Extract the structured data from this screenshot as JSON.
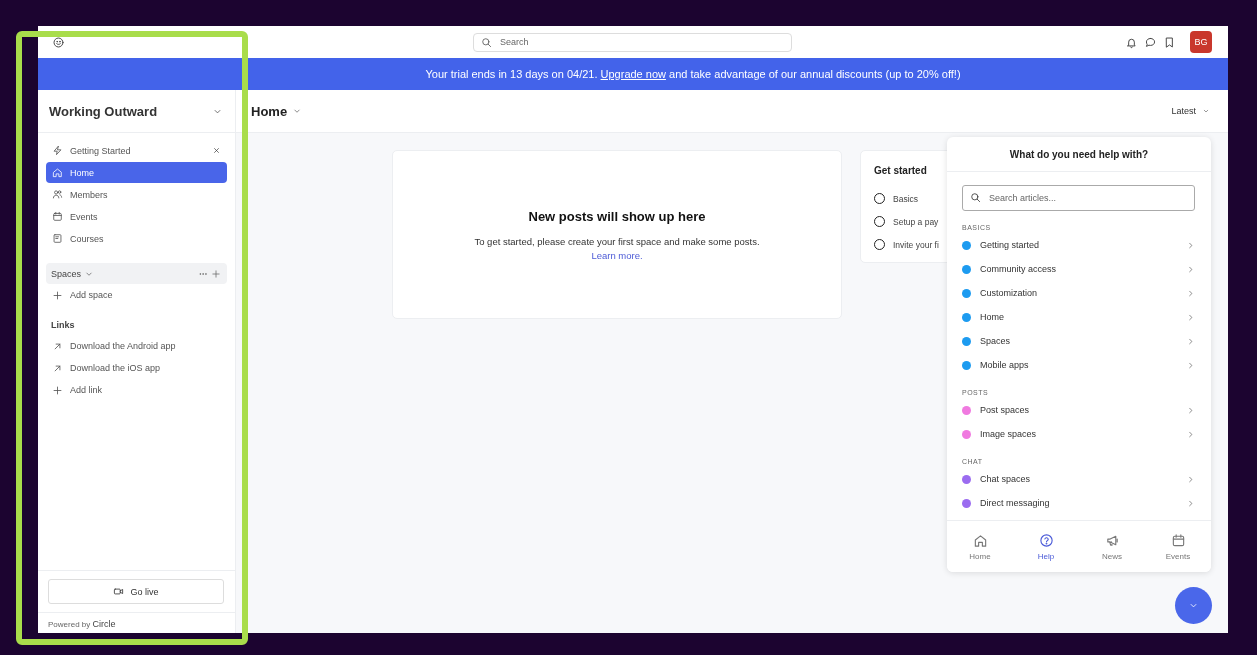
{
  "topbar": {
    "search": {
      "placeholder": "Search"
    },
    "avatar": "BG"
  },
  "banner": {
    "before": "Your trial ends in 13 days on 04/21.",
    "link": "Upgrade now",
    "after": "and take advantage of our annual discounts (up to 20% off!)"
  },
  "sidebar": {
    "title": "Working Outward",
    "nav": [
      {
        "label": "Getting Started",
        "kind": "bolt",
        "closable": true,
        "selected": false
      },
      {
        "label": "Home",
        "kind": "home",
        "closable": false,
        "selected": true
      },
      {
        "label": "Members",
        "kind": "people",
        "closable": false,
        "selected": false
      },
      {
        "label": "Events",
        "kind": "calendar",
        "closable": false,
        "selected": false
      },
      {
        "label": "Courses",
        "kind": "book",
        "closable": false,
        "selected": false
      }
    ],
    "spaces": {
      "label": "Spaces",
      "add": "Add space"
    },
    "links_heading": "Links",
    "links": [
      {
        "label": "Download the Android app",
        "kind": "external"
      },
      {
        "label": "Download the iOS app",
        "kind": "external"
      },
      {
        "label": "Add link",
        "kind": "add"
      }
    ],
    "go_live": "Go live",
    "powered": "Powered by **Circle**"
  },
  "main": {
    "title": "Home",
    "sort": "Latest",
    "empty": {
      "heading": "New posts will show up here",
      "text": "To get started, please create your first space and make some posts.",
      "link": "Learn more."
    },
    "get_started": {
      "title": "Get started",
      "steps": [
        {
          "label": "Basics",
          "done": false
        },
        {
          "label": "Setup a pay",
          "done": false
        },
        {
          "label": "Invite your fi",
          "done": false
        }
      ]
    }
  },
  "help": {
    "title": "What do you need help with?",
    "search": {
      "placeholder": "Search articles..."
    },
    "sections": [
      {
        "heading": "BASICS",
        "items": [
          {
            "label": "Getting started",
            "color": "#1d9bf0"
          },
          {
            "label": "Community access",
            "color": "#1d9bf0"
          },
          {
            "label": "Customization",
            "color": "#1d9bf0"
          },
          {
            "label": "Home",
            "color": "#1d9bf0"
          },
          {
            "label": "Spaces",
            "color": "#1d9bf0"
          },
          {
            "label": "Mobile apps",
            "color": "#1d9bf0"
          }
        ]
      },
      {
        "heading": "POSTS",
        "items": [
          {
            "label": "Post spaces",
            "color": "#f07ae0"
          },
          {
            "label": "Image spaces",
            "color": "#f07ae0"
          }
        ]
      },
      {
        "heading": "CHAT",
        "items": [
          {
            "label": "Chat spaces",
            "color": "#9b6cf0"
          },
          {
            "label": "Direct messaging",
            "color": "#9b6cf0"
          }
        ]
      }
    ],
    "tabs": [
      {
        "label": "Home",
        "kind": "home",
        "selected": false
      },
      {
        "label": "Help",
        "kind": "help",
        "selected": true
      },
      {
        "label": "News",
        "kind": "megaphone",
        "selected": false
      },
      {
        "label": "Events",
        "kind": "calendar",
        "selected": false
      }
    ]
  }
}
